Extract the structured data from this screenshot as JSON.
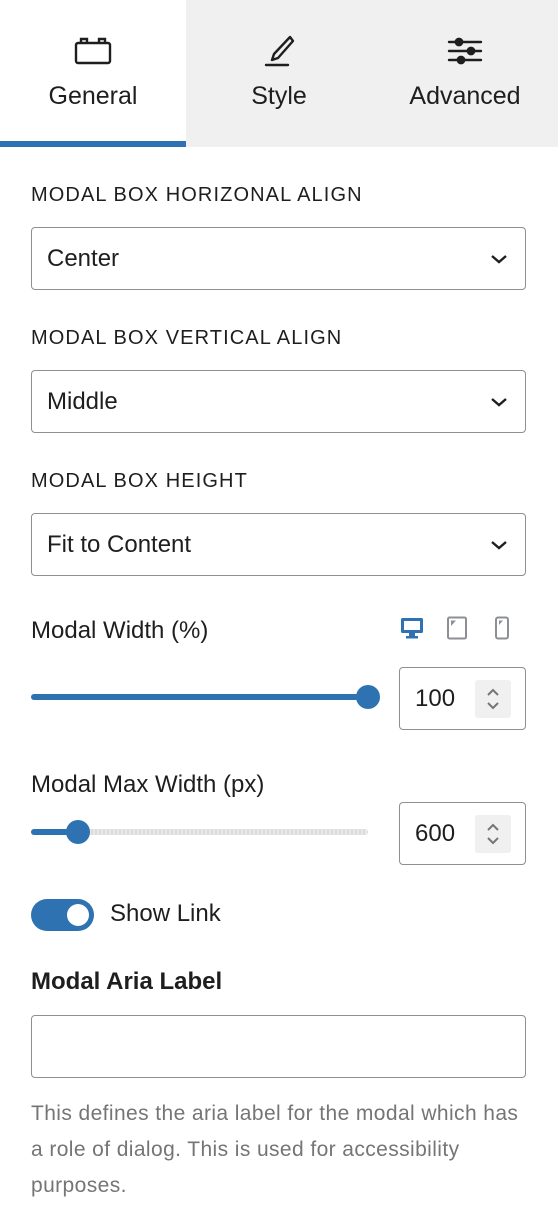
{
  "tabs": [
    {
      "label": "General",
      "icon": "toolbox-icon",
      "active": true
    },
    {
      "label": "Style",
      "icon": "brush-icon",
      "active": false
    },
    {
      "label": "Advanced",
      "icon": "sliders-icon",
      "active": false
    }
  ],
  "horizontal_align": {
    "label": "MODAL BOX HORIZONAL ALIGN",
    "value": "Center"
  },
  "vertical_align": {
    "label": "MODAL BOX VERTICAL ALIGN",
    "value": "Middle"
  },
  "height": {
    "label": "MODAL BOX HEIGHT",
    "value": "Fit to Content"
  },
  "modal_width": {
    "label": "Modal Width (%)",
    "value": "100",
    "min": 0,
    "max": 100,
    "devices": [
      "desktop-icon",
      "tablet-icon",
      "mobile-icon"
    ],
    "active_device": "desktop-icon"
  },
  "modal_max_width": {
    "label": "Modal Max Width (px)",
    "value": "600",
    "slider_fraction": 0.14
  },
  "show_link": {
    "label": "Show Link",
    "checked": true
  },
  "aria_label": {
    "label": "Modal Aria Label",
    "value": "",
    "help": "This defines the aria label for the modal which has a role of dialog. This is used for accessibility purposes."
  },
  "colors": {
    "accent": "#2f72b1",
    "tab_bg": "#f0f0f1",
    "border": "#8c8f94",
    "help_text": "#757575"
  }
}
